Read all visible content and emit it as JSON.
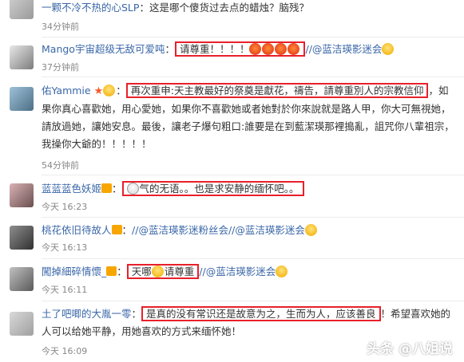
{
  "comments": [
    {
      "user": "一颗不冷不热的心SLP",
      "text": "这是哪个傻货过去点的蜡烛？脑残？",
      "time": "34分钟前"
    },
    {
      "user": "Mango宇宙超级无敌可爱吨",
      "text": "请尊重！！！！",
      "mention": "//@蓝洁瑛影迷会",
      "time": "37分钟前"
    },
    {
      "user": "佑Yammie",
      "text_boxed": "再次重申:天主教最好的祭奠是獻花，禱告，請尊重別人的宗教信仰",
      "text_rest": "，如果你真心喜歡她，用心愛她，如果你不喜歡她或者她對於你來說就是路人甲，你大可無視她，請放過她，讓她安息。最後，讓老子爆句粗口:誰要是在到藍潔瑛那裡搗亂，詛咒你八輩祖宗，我操你大爺的！！！！！",
      "time": "54分钟前"
    },
    {
      "user": "蓝蓝蓝色妖姬",
      "text": "气的无语。。也是求安静的缅怀吧。。",
      "time": "今天 16:23"
    },
    {
      "user": "桃花依旧待故人",
      "mention1": "//@蓝洁瑛影迷粉丝会",
      "mention2": "//@蓝洁瑛影迷会",
      "time": "今天 16:13"
    },
    {
      "user": "闖掉細碎情懷_",
      "text_pre": "天哪",
      "text_post": "请尊重",
      "mention": "//@蓝洁瑛影迷会",
      "time": "今天 16:11"
    },
    {
      "user": "土了吧唧的大胤一零",
      "text_boxed": "是真的没有常识还是故意为之，生而为人，应该善良",
      "text_rest": "！希望喜欢她的人可以给她平静，用她喜欢的方式来缅怀她！",
      "time": "今天 16:09"
    }
  ],
  "watermark": "头条 @八姐说"
}
